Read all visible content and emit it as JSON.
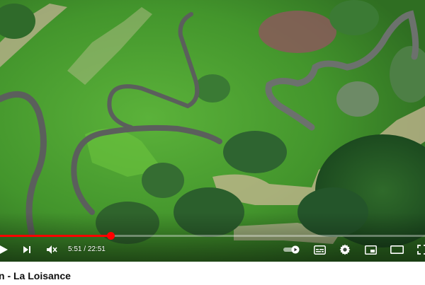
{
  "player": {
    "progress_fraction": 0.26,
    "time_current": "5:51",
    "time_total": "22:51",
    "time_separator": " / ",
    "colors": {
      "played": "#ff0000",
      "track": "#ffffff",
      "control_icon": "#ffffff"
    },
    "controls": [
      {
        "name": "play-icon",
        "label": "play"
      },
      {
        "name": "next-icon",
        "label": "next"
      },
      {
        "name": "mute-icon",
        "label": "muted volume"
      },
      {
        "name": "autoplay-toggle-icon",
        "label": "autoplay"
      },
      {
        "name": "subtitles-icon",
        "label": "subtitles"
      },
      {
        "name": "settings-gear-icon",
        "label": "settings"
      },
      {
        "name": "miniplayer-icon",
        "label": "miniplayer"
      },
      {
        "name": "theater-mode-icon",
        "label": "theater mode"
      },
      {
        "name": "fullscreen-icon",
        "label": "fullscreen"
      }
    ]
  },
  "video": {
    "title": "n - La Loisance"
  }
}
